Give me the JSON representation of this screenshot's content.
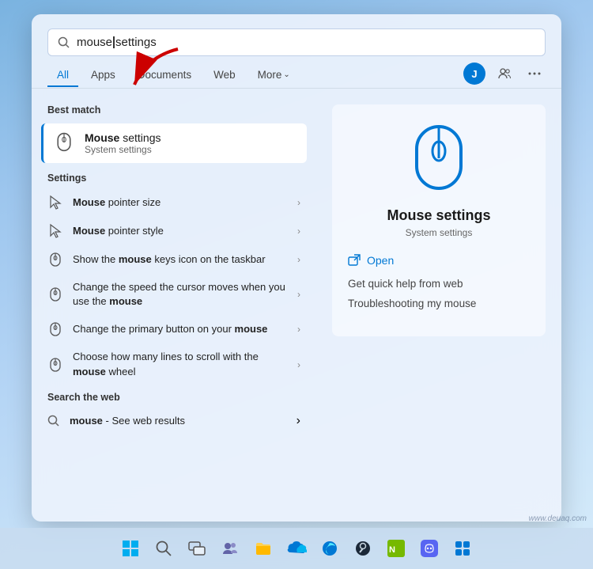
{
  "search": {
    "value": "mouse settings",
    "value_pre": "mouse",
    "value_post": " settings"
  },
  "tabs": {
    "all": "All",
    "apps": "Apps",
    "documents": "Documents",
    "web": "Web",
    "more": "More"
  },
  "best_match": {
    "section_label": "Best match",
    "title_normal": "Mouse",
    "title_bold": "Mouse",
    "title_suffix": " settings",
    "subtitle": "System settings"
  },
  "settings_section": {
    "label": "Settings",
    "items": [
      {
        "text_pre": "Mouse",
        "text_mid": " pointer size",
        "has_bold": true
      },
      {
        "text_pre": "Mouse",
        "text_mid": " pointer style",
        "has_bold": true
      },
      {
        "text_pre": "Show the ",
        "text_bold": "mouse",
        "text_post": " keys icon on the taskbar",
        "has_bold": true
      },
      {
        "text_pre": "Change the speed the cursor moves when you use the ",
        "text_bold": "mouse",
        "has_bold": true
      },
      {
        "text_pre": "Change the primary button on your ",
        "text_bold": "mouse",
        "has_bold": true
      },
      {
        "text_pre": "Choose how many lines to scroll with the ",
        "text_bold": "mouse",
        "text_post": " wheel",
        "has_bold": true
      }
    ]
  },
  "search_web": {
    "label": "Search the web",
    "item_pre": "mouse",
    "item_post": " - See web results"
  },
  "detail": {
    "title": "Mouse settings",
    "subtitle": "System settings",
    "open_label": "Open",
    "quick_help": "Get quick help from web",
    "troubleshoot": "Troubleshooting my mouse"
  },
  "taskbar_icons": [
    "windows-icon",
    "search-icon",
    "file-explorer-icon",
    "teams-icon",
    "folder-icon",
    "onedrive-icon",
    "browser-icon",
    "steam-icon",
    "nvidia-icon",
    "discord-icon",
    "settings-icon"
  ],
  "watermark": "www.deuaq.com"
}
